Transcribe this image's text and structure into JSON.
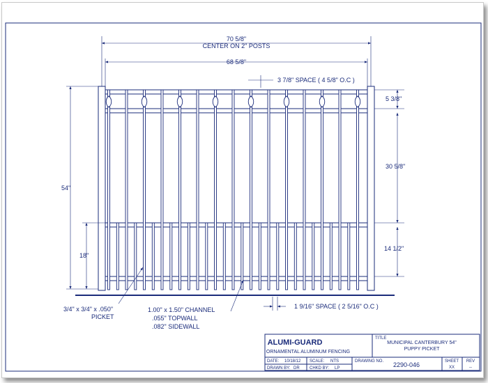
{
  "colors": {
    "ink": "#1a2b7a",
    "paper": "#ffffff",
    "shadow": "#000000"
  },
  "dimensions": {
    "overall_width": "70 5/8\"",
    "overall_width_note": "CENTER ON 2\" POSTS",
    "panel_width": "68 5/8\"",
    "top_space": "3 7/8\" SPACE ( 4 5/8\" O.C )",
    "top_section": "5 3/8\"",
    "middle_section": "30 5/8\"",
    "bottom_section": "14 1/2\"",
    "overall_height": "54\"",
    "lower_height": "18\"",
    "bottom_space": "1 9/16\" SPACE ( 2 5/16\" O.C )"
  },
  "callouts": {
    "picket_line1": "3/4\" x 3/4\" x .050\"",
    "picket_line2": "PICKET",
    "channel_line1": "1.00\" x 1.50\" CHANNEL",
    "channel_line2": ".055\" TOPWALL",
    "channel_line3": ".082\" SIDEWALL"
  },
  "title_block": {
    "company": "ALUMI-GUARD",
    "company_sub": "ORNAMENTAL ALUMINUM FENCING",
    "title_label": "TITLE",
    "title_line1": "MUNICIPAL CANTERBURY 54\"",
    "title_line2": "PUPPY PICKET",
    "date_label": "DATE:",
    "date_value": "10/18/12",
    "scale_label": "SCALE:",
    "scale_value": "NTS",
    "drawing_no_label": "DRAWING NO.",
    "drawing_no_value": "2290-046",
    "sheet_label": "SHEET",
    "sheet_value": "XX",
    "rev_label": "REV",
    "rev_value": "--",
    "drawn_by_label": "DRAWN BY:",
    "drawn_by_value": "DR",
    "chkd_by_label": "CHKD BY:",
    "chkd_by_value": "LP"
  }
}
